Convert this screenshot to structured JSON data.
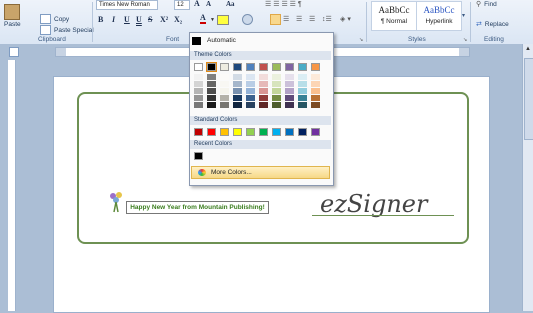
{
  "ribbon": {
    "clipboard": {
      "paste": "Paste",
      "copy": "Copy",
      "paste_special": "Paste Special",
      "label": "Clipboard"
    },
    "font": {
      "name": "Times New Roman",
      "size": "12",
      "label": "Font",
      "bold": "B",
      "italic": "I",
      "underline": "U",
      "underline2": "U",
      "strike": "S",
      "superscript": "X²",
      "subscript": "X₂",
      "font_color_btn": "A",
      "grow": "A",
      "shrink": "A",
      "case": "Aa"
    },
    "styles": {
      "label": "Styles",
      "items": [
        {
          "preview": "AaBbCc",
          "name": "¶ Normal"
        },
        {
          "preview": "AaBbCc",
          "name": "Hyperlink"
        }
      ]
    },
    "editing": {
      "label": "Editing",
      "find": "Find",
      "replace": "Replace"
    }
  },
  "color_menu": {
    "automatic": "Automatic",
    "theme_header": "Theme Colors",
    "standard_header": "Standard Colors",
    "recent_header": "Recent Colors",
    "more": "More Colors...",
    "theme_colors": [
      "#ffffff",
      "#000000",
      "#eeece1",
      "#1f497d",
      "#4f81bd",
      "#c0504d",
      "#9bbb59",
      "#8064a2",
      "#4bacc6",
      "#f79646"
    ],
    "standard_colors": [
      "#c00000",
      "#ff0000",
      "#ffc000",
      "#ffff00",
      "#92d050",
      "#00b050",
      "#00b0f0",
      "#0070c0",
      "#002060",
      "#7030a0"
    ],
    "recent_colors": [
      "#000000"
    ]
  },
  "document": {
    "greeting": "Happy New Year from Mountain Publishing!",
    "signature": "ezSigner"
  }
}
